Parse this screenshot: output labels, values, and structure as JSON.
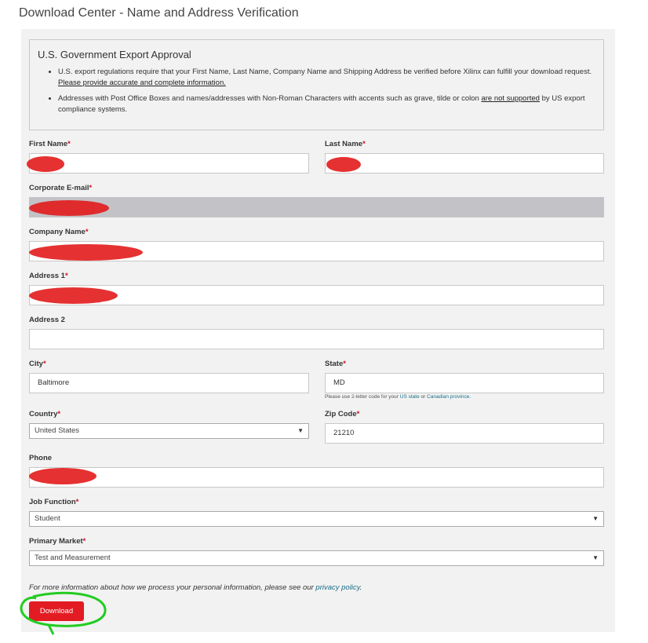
{
  "page_title": "Download Center - Name and Address Verification",
  "notice": {
    "heading": "U.S. Government Export Approval",
    "bullet1": "U.S. export regulations require that your First Name, Last Name, Company Name and Shipping Address be verified before Xilinx can fulfill your download request.",
    "bullet1_link": "Please provide accurate and complete information.",
    "bullet2_pre": "Addresses with Post Office Boxes and names/addresses with Non-Roman Characters with accents such as grave, tilde or colon",
    "bullet2_em": "are not supported",
    "bullet2_post": "by US export compliance systems."
  },
  "form": {
    "first_name": {
      "label": "First Name",
      "value": ""
    },
    "last_name": {
      "label": "Last Name",
      "value": ""
    },
    "email": {
      "label": "Corporate E-mail",
      "value": ""
    },
    "company": {
      "label": "Company Name",
      "value": ""
    },
    "address1": {
      "label": "Address 1",
      "value": ""
    },
    "address2": {
      "label": "Address 2",
      "value": ""
    },
    "city": {
      "label": "City",
      "value": "Baltimore"
    },
    "state": {
      "label": "State",
      "value": "MD",
      "hint_pre": "Please use 2-letter code for your",
      "hint_link1": "US state",
      "hint_mid": "or",
      "hint_link2": "Canadian province."
    },
    "country": {
      "label": "Country",
      "value": "United States"
    },
    "zip": {
      "label": "Zip Code",
      "value": "21210"
    },
    "phone": {
      "label": "Phone",
      "value": ""
    },
    "job": {
      "label": "Job Function",
      "value": "Student"
    },
    "market": {
      "label": "Primary Market",
      "value": "Test and Measurement"
    },
    "required_mark": "*"
  },
  "privacy": {
    "text": "For more information about how we process your personal information, please see our",
    "link": "privacy policy"
  },
  "download_label": "Download",
  "colors": {
    "accent": "#e31b23",
    "redaction": "#e21b1b",
    "annotation": "#22cc22"
  }
}
